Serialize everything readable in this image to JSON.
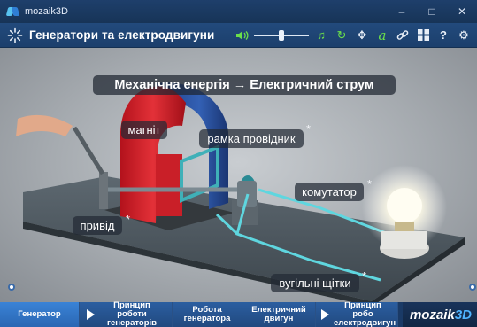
{
  "window": {
    "app_name": "mozaik3D",
    "minimize": "–",
    "maximize": "□",
    "close": "✕"
  },
  "toolbar": {
    "title": "Генератори та електродвигуни",
    "volume_level": 0.5,
    "icons": [
      "sound-icon",
      "volume-slider",
      "music-icon",
      "restart-icon",
      "move-icon",
      "annotation-icon",
      "link-icon",
      "grid-icon",
      "help-icon",
      "settings-icon"
    ]
  },
  "scene": {
    "headline": "Механічна енергія → Електричний струм",
    "labels": {
      "magnet": "магніт",
      "conductor_frame": "рамка провідник",
      "commutator": "комутатор",
      "drive": "привід",
      "carbon_brushes": "вугільні щітки"
    },
    "star": "*"
  },
  "tabs": [
    {
      "label": "Генератор",
      "active": true,
      "play": false
    },
    {
      "label": "Принцип роботи генераторів",
      "active": false,
      "play": true
    },
    {
      "label": "Робота генератора",
      "active": false,
      "play": false
    },
    {
      "label": "Електричний двигун",
      "active": false,
      "play": false
    },
    {
      "label": "Принцип робо електродвигун",
      "active": false,
      "play": true
    }
  ],
  "brand": {
    "text": "mozaik",
    "suffix": "3D"
  },
  "colors": {
    "accent_green": "#6be04a",
    "active_tab": "#3a83d6",
    "brand_blue": "#4fb3ff"
  }
}
